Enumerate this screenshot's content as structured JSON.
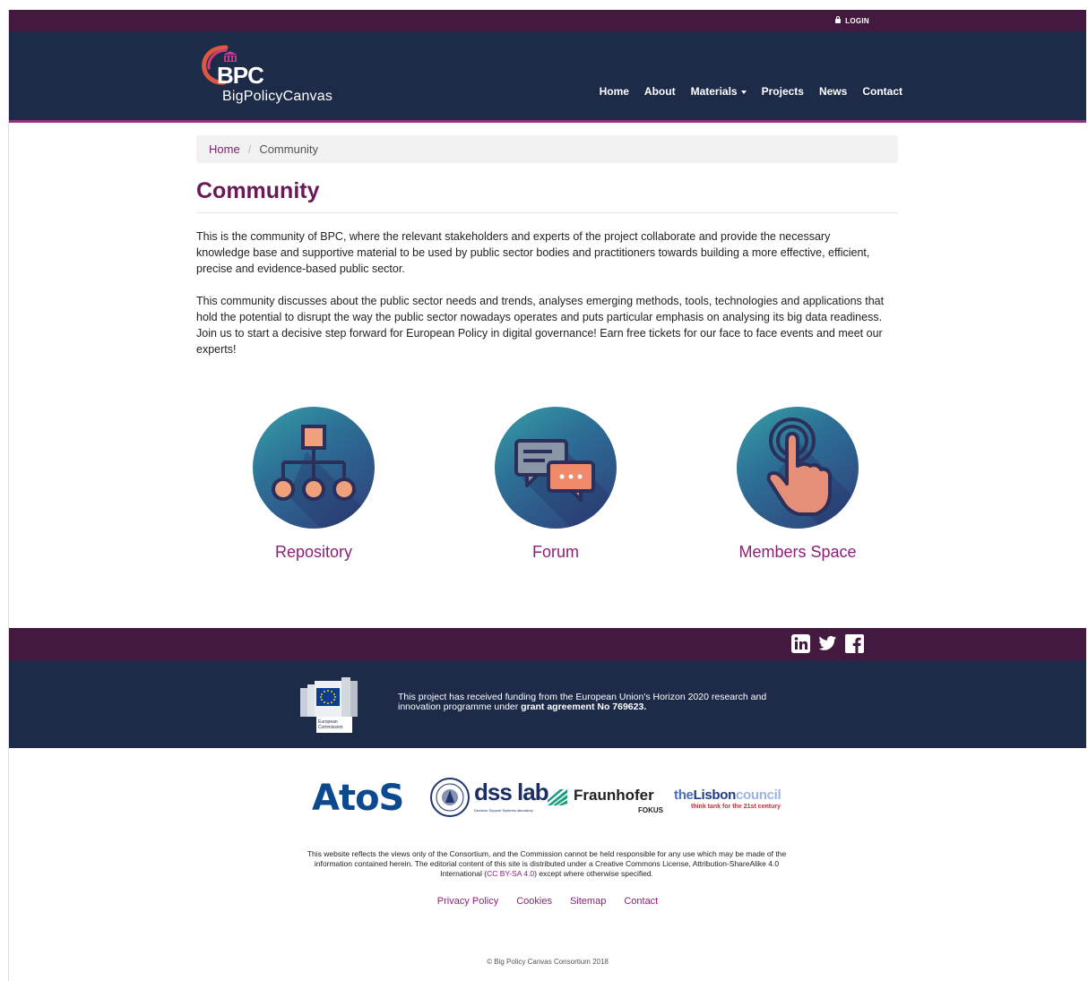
{
  "topbar": {
    "login_label": "LOGIN"
  },
  "header": {
    "logo_short": "BPC",
    "logo_name": "BigPolicyCanvas",
    "nav": [
      {
        "label": "Home"
      },
      {
        "label": "About"
      },
      {
        "label": "Materials"
      },
      {
        "label": "Projects"
      },
      {
        "label": "News"
      },
      {
        "label": "Contact"
      }
    ]
  },
  "breadcrumb": {
    "home": "Home",
    "separator": "/",
    "current": "Community"
  },
  "page": {
    "title": "Community",
    "paragraph1": "This is the community of BPC, where the relevant stakeholders and experts of the project collaborate and provide the necessary knowledge base and supportive material to be used by public sector bodies and practitioners towards building a more effective, efficient, precise and evidence-based public sector.",
    "paragraph2": "This community discusses about the public sector needs and trends, analyses emerging methods, tools, technologies and applications that hold the potential to disrupt the way the public sector nowadays operates and puts particular emphasis on analysing its big data readiness.",
    "paragraph3": "Join us to start a decisive step forward for European Policy in digital governance! Earn free tickets for our face to face events and meet our experts!"
  },
  "cards": [
    {
      "label": "Repository",
      "icon": "hierarchy-icon"
    },
    {
      "label": "Forum",
      "icon": "chat-bubbles-icon"
    },
    {
      "label": "Members Space",
      "icon": "touch-hand-icon"
    }
  ],
  "footer": {
    "social": [
      "linkedin-icon",
      "twitter-icon",
      "facebook-icon"
    ],
    "ec_logo_text": "European Commission",
    "funding_text": "This project has received funding from the European Union's Horizon 2020 research and innovation programme under ",
    "funding_bold": "grant agreement No 769623.",
    "partners": {
      "atos": "AtoS",
      "dss": "dss lab",
      "dss_sub": "Decision Support Systems laboratory",
      "fraunhofer": "Fraunhofer",
      "fokus": "FOKUS",
      "lisbon_the": "the",
      "lisbon_name": "Lisbon",
      "lisbon_council": "council",
      "lisbon_sub": "think tank for the 21st century"
    },
    "disclaimer_pre": "This website reflects the views only of the Consortium, and the Commission cannot be held responsible for any use which may be made of the information contained herein. The editorial content of this site is distributed under a Creative Commons License, Attribution-ShareAlike 4.0 International (",
    "disclaimer_link": "CC BY-SA 4.0",
    "disclaimer_post": ") except where otherwise specified.",
    "links": [
      {
        "label": "Privacy Policy"
      },
      {
        "label": "Cookies"
      },
      {
        "label": "Sitemap"
      },
      {
        "label": "Contact"
      }
    ],
    "copyright": "© Big Policy Canvas Consortium 2018"
  },
  "colors": {
    "topbar": "#44193f",
    "header": "#1d2b48",
    "accent": "#8c1f75",
    "title": "#6a1a55"
  }
}
